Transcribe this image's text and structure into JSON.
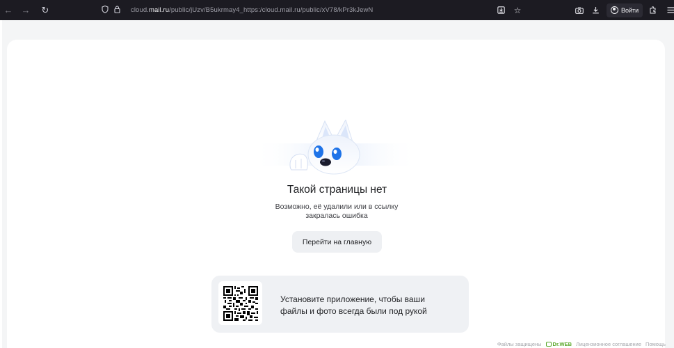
{
  "browser": {
    "url_prefix": "cloud.",
    "url_domain": "mail.ru",
    "url_rest": "/public/jUzv/B5ukrmay4_https:/cloud.mail.ru/public/xV78/kPr3kJewN",
    "login_label": "Войти"
  },
  "page": {
    "title": "Такой страницы нет",
    "subtitle_line1": "Возможно, её удалили или в ссылку",
    "subtitle_line2": "закралась ошибка",
    "home_button": "Перейти на главную",
    "banner_line1": "Установите приложение, чтобы ваши",
    "banner_line2": "файлы и фото всегда были под рукой"
  },
  "footer": {
    "protected_label": "Файлы защищены",
    "drweb_label": "Dr.WEB",
    "license_label": "Лицензионное соглашение",
    "help_label": "Помощь"
  },
  "colors": {
    "toolbar_bg": "#1c1b22",
    "page_bg": "#f4f5f6",
    "card_bg": "#ffffff",
    "button_bg": "#eef0f3",
    "mascot_eye": "#1e73e8"
  },
  "icons": [
    "back-arrow-icon",
    "forward-arrow-icon",
    "reload-icon",
    "shield-icon",
    "lock-icon",
    "save-page-icon",
    "star-icon",
    "screenshot-icon",
    "download-icon",
    "account-icon",
    "extensions-icon",
    "menu-icon",
    "qr-code-icon",
    "drweb-icon"
  ]
}
